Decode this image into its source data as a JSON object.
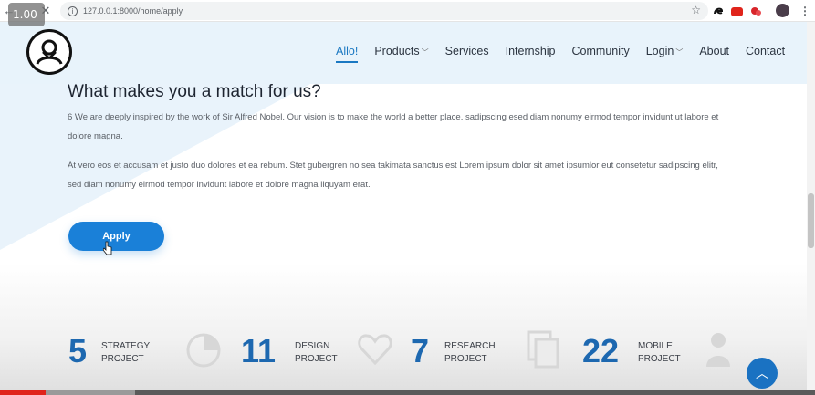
{
  "browser": {
    "url": "127.0.0.1:8000/home/apply",
    "zoom": "1.00"
  },
  "nav": {
    "items": [
      {
        "label": "Allo!",
        "active": true,
        "dropdown": false
      },
      {
        "label": "Products",
        "active": false,
        "dropdown": true
      },
      {
        "label": "Services",
        "active": false,
        "dropdown": false
      },
      {
        "label": "Internship",
        "active": false,
        "dropdown": false
      },
      {
        "label": "Community",
        "active": false,
        "dropdown": false
      },
      {
        "label": "Login",
        "active": false,
        "dropdown": true
      },
      {
        "label": "About",
        "active": false,
        "dropdown": false
      },
      {
        "label": "Contact",
        "active": false,
        "dropdown": false
      }
    ]
  },
  "content": {
    "heading": "What makes you a match for us?",
    "paragraph1": "6 We are deeply inspired by the work of Sir Alfred Nobel. Our vision is to make the world a better place. sadipscing esed diam nonumy eirmod tempor invidunt ut labore et dolore magna.",
    "paragraph2": "At vero eos et accusam et justo duo dolores et ea rebum. Stet gubergren no sea takimata sanctus est Lorem ipsum dolor sit amet ipsumlor eut consetetur sadipscing elitr, sed diam nonumy eirmod tempor invidunt labore et dolore magna liquyam erat.",
    "apply_label": "Apply"
  },
  "stats": [
    {
      "number": "5",
      "line1": "STRATEGY",
      "line2": "PROJECT",
      "icon": "pie-chart-icon"
    },
    {
      "number": "11",
      "line1": "DESIGN",
      "line2": "PROJECT",
      "icon": "heart-icon"
    },
    {
      "number": "7",
      "line1": "RESEARCH",
      "line2": "PROJECT",
      "icon": "copy-icon"
    },
    {
      "number": "22",
      "line1": "MOBILE",
      "line2": "PROJECT",
      "icon": "user-icon"
    }
  ],
  "colors": {
    "accent": "#1a80d8",
    "stat_number": "#1d68b0",
    "header_bg": "#e8f3fb"
  },
  "video_progress": {
    "played_fraction": 0.056,
    "buffered_fraction": 0.166
  }
}
